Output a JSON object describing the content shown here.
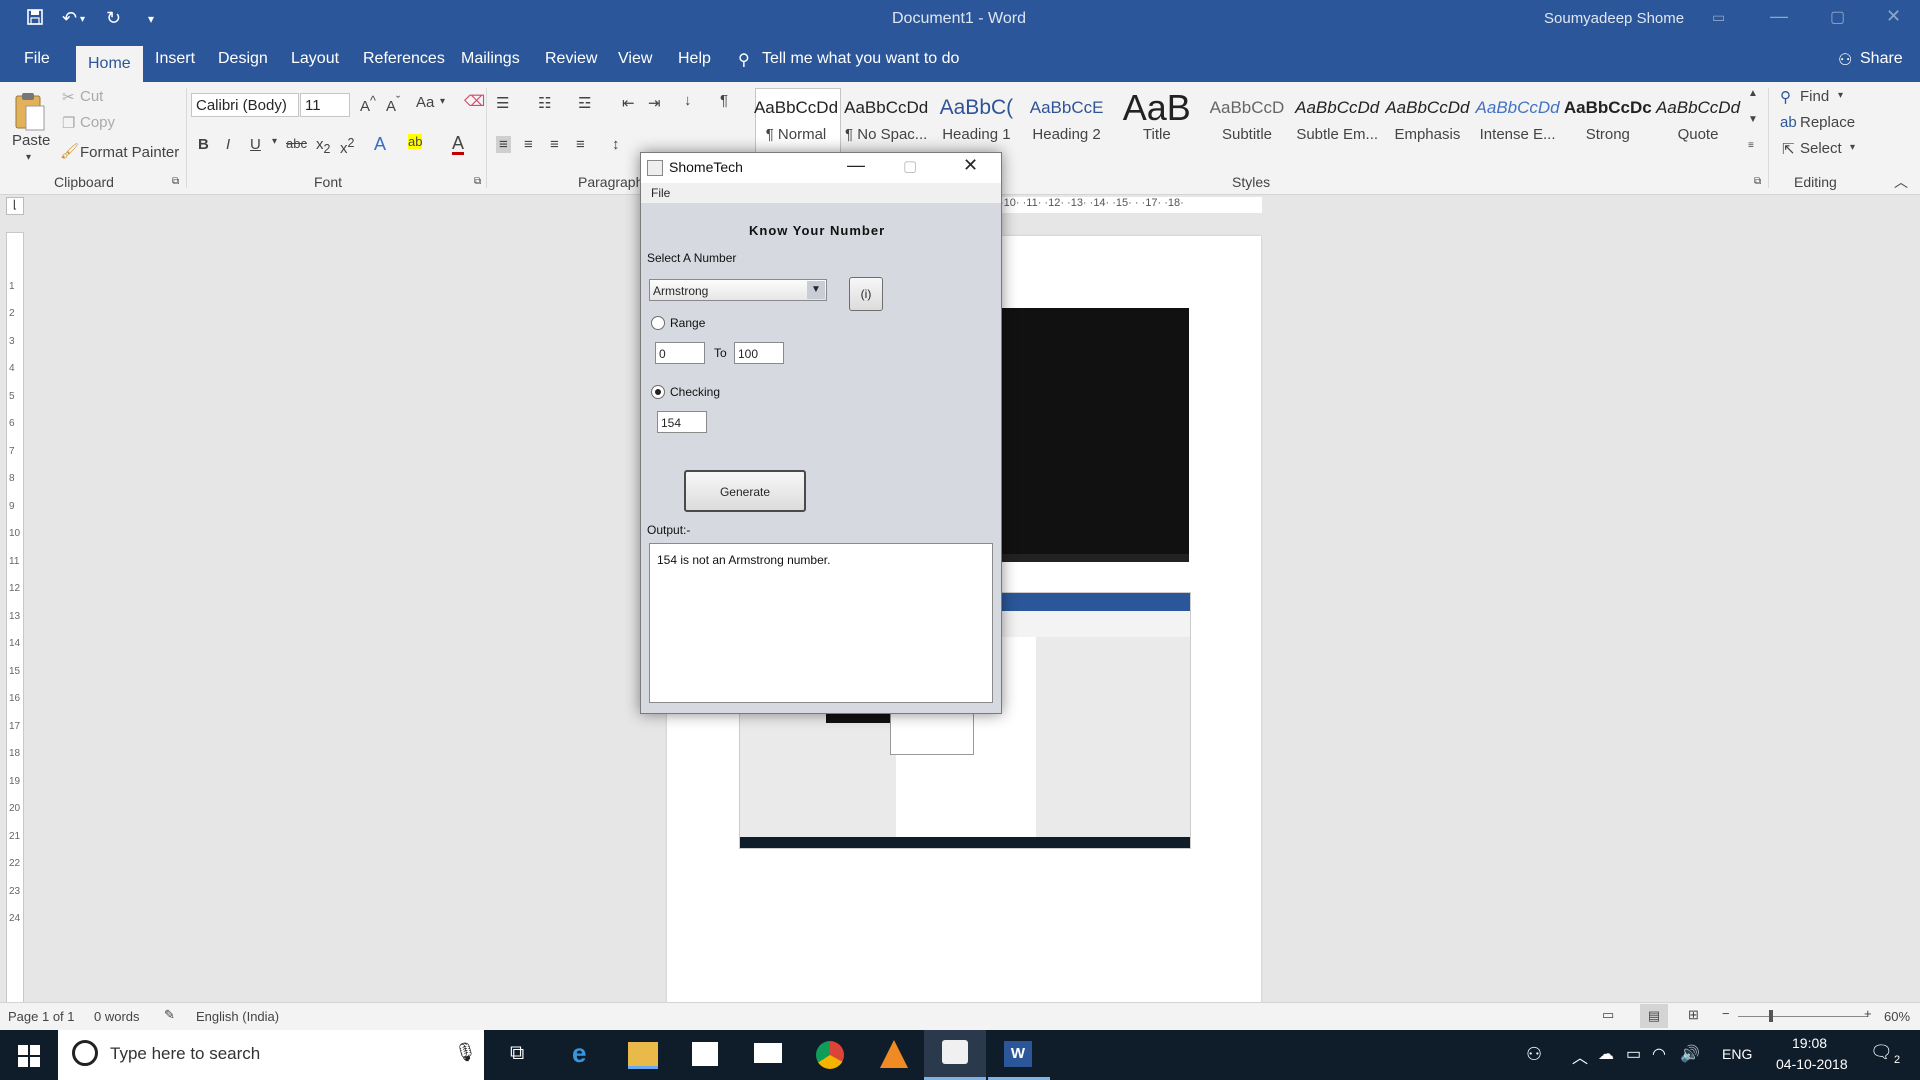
{
  "window": {
    "title": "Document1 - Word",
    "user": "Soumyadeep Shome"
  },
  "tabs": [
    "File",
    "Home",
    "Insert",
    "Design",
    "Layout",
    "References",
    "Mailings",
    "Review",
    "View",
    "Help"
  ],
  "tell_me": "Tell me what you want to do",
  "share": "Share",
  "clipboard": {
    "paste": "Paste",
    "cut": "Cut",
    "copy": "Copy",
    "format_painter": "Format Painter",
    "label": "Clipboard"
  },
  "font": {
    "name": "Calibri (Body)",
    "size": "11",
    "label": "Font",
    "change_case": "Aa"
  },
  "paragraph_label": "Paragraph",
  "styles": {
    "label": "Styles",
    "items": [
      {
        "sample": "AaBbCcDd",
        "name": "¶ Normal"
      },
      {
        "sample": "AaBbCcDd",
        "name": "¶ No Spac..."
      },
      {
        "sample": "AaBbC(",
        "name": "Heading 1"
      },
      {
        "sample": "AaBbCcE",
        "name": "Heading 2"
      },
      {
        "sample": "AaB",
        "name": "Title"
      },
      {
        "sample": "AaBbCcD",
        "name": "Subtitle"
      },
      {
        "sample": "AaBbCcDd",
        "name": "Subtle Em..."
      },
      {
        "sample": "AaBbCcDd",
        "name": "Emphasis"
      },
      {
        "sample": "AaBbCcDd",
        "name": "Intense E..."
      },
      {
        "sample": "AaBbCcDc",
        "name": "Strong"
      },
      {
        "sample": "AaBbCcDd",
        "name": "Quote"
      }
    ]
  },
  "editing": {
    "find": "Find",
    "replace": "Replace",
    "select": "Select",
    "label": "Editing"
  },
  "ruler": {
    "marks": "·10· ·11· ·12· ·13· ·14· ·15· · ·17· ·18·"
  },
  "status": {
    "page": "Page 1 of 1",
    "words": "0 words",
    "language": "English (India)",
    "zoom": "60%"
  },
  "taskbar": {
    "search_placeholder": "Type here to search",
    "lang": "ENG",
    "time": "19:08",
    "date": "04-10-2018",
    "notifications": "2"
  },
  "dialog": {
    "title": "ShomeTech",
    "menu_file": "File",
    "heading": "Know Your Number",
    "select_label": "Select A Number",
    "selected_option": "Armstrong",
    "info_button": "(i)",
    "range_label": "Range",
    "range_from": "0",
    "range_to_label": "To",
    "range_to": "100",
    "checking_label": "Checking",
    "checking_value": "154",
    "generate_button": "Generate",
    "output_label": "Output:-",
    "output_text": "154 is not an Armstrong number."
  },
  "colors": {
    "word_blue": "#2b579a",
    "taskbar": "#0f1d2b",
    "dialog_bg": "#d6d9df"
  }
}
